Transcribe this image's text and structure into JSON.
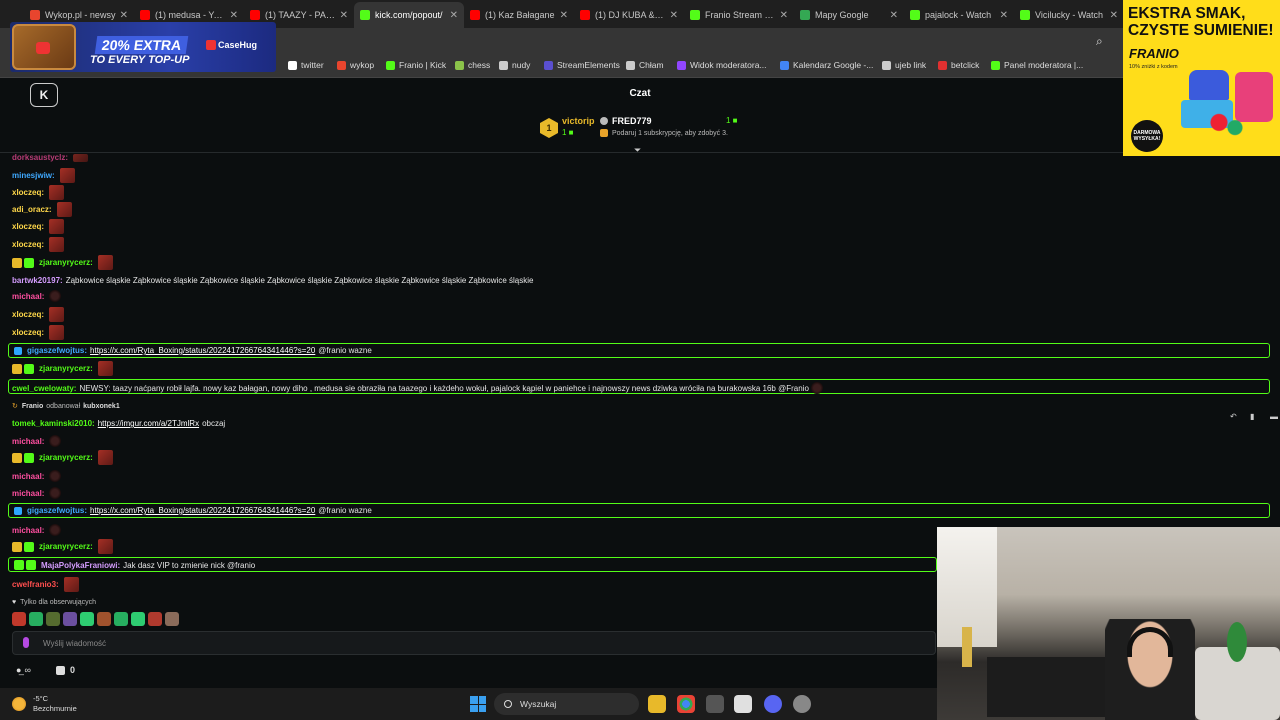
{
  "tabs": [
    {
      "title": "Wykop.pl - newsy",
      "color": "#e8452e",
      "active": false
    },
    {
      "title": "(1) medusa - YouT",
      "color": "#ff0000",
      "active": false
    },
    {
      "title": "(1) TAAZY - PACZ",
      "color": "#ff0000",
      "active": false
    },
    {
      "title": "kick.com/popout/",
      "color": "#53fc18",
      "active": true
    },
    {
      "title": "(1) Kaz Bałagane",
      "color": "#ff0000",
      "active": false
    },
    {
      "title": "(1) DJ KUBA & NE",
      "color": "#ff0000",
      "active": false
    },
    {
      "title": "Franio Stream - W",
      "color": "#53fc18",
      "active": false
    },
    {
      "title": "Mapy Google",
      "color": "#34a853",
      "active": false
    },
    {
      "title": "pajalock - Watch",
      "color": "#53fc18",
      "active": false
    },
    {
      "title": "Vicilucky - Watch",
      "color": "#53fc18",
      "active": false
    }
  ],
  "bookmarks": [
    {
      "label": "twitter",
      "color": "#ffffff"
    },
    {
      "label": "wykop",
      "color": "#e8452e"
    },
    {
      "label": "Franio | Kick",
      "color": "#53fc18"
    },
    {
      "label": "chess",
      "color": "#8bc34a"
    },
    {
      "label": "nudy",
      "color": "#cccccc"
    },
    {
      "label": "StreamElements",
      "color": "#5a4fcf"
    },
    {
      "label": "Chłam",
      "color": "#cccccc"
    },
    {
      "label": "Widok moderatora...",
      "color": "#9146ff"
    },
    {
      "label": "Kalendarz Google -...",
      "color": "#4285f4"
    },
    {
      "label": "ujeb link",
      "color": "#cccccc"
    },
    {
      "label": "betclick",
      "color": "#e03030"
    },
    {
      "label": "Panel moderatora |...",
      "color": "#53fc18"
    }
  ],
  "ad_left": {
    "percent": "20% EXTRA",
    "subline": "TO EVERY TOP-UP",
    "brand": "CaseHug"
  },
  "ad_right": {
    "headline": "EKSTRA SMAK, CZYSTE SUMIENIE!",
    "brand": "FRANIO",
    "small": "10% zniżki z kodem",
    "badge": "DARMOWA WYSYŁKA!"
  },
  "header": {
    "title": "Czat",
    "logo": "K"
  },
  "leaderboard": {
    "rank": "1",
    "user1": "victorip",
    "count1": "1",
    "user2": "FRED779",
    "count2": "1",
    "note": "Podaruj 1 subskrypcję, aby zdobyć 3."
  },
  "chat": [
    {
      "user": "minesjwiw:",
      "color": "#3fa9ff",
      "text": "",
      "link": "",
      "tail": ""
    },
    {
      "user": "xloczeq:",
      "color": "#ffd84a",
      "text": "",
      "link": "",
      "tail": ""
    },
    {
      "user": "adi_oracz:",
      "color": "#ffd84a",
      "text": "",
      "link": "",
      "tail": ""
    },
    {
      "user": "xloczeq:",
      "color": "#ffd84a",
      "text": "",
      "link": "",
      "tail": ""
    },
    {
      "user": "xloczeq:",
      "color": "#ffd84a",
      "text": "",
      "link": "",
      "tail": ""
    },
    {
      "user": "zjaranyrycerz:",
      "color": "#53fc18",
      "text": "",
      "link": "",
      "tail": ""
    },
    {
      "user": "bartwk20197:",
      "color": "#d59dff",
      "text": "Ząbkowice śląskie Ząbkowice śląskie Ząbkowice śląskie Ząbkowice śląskie Ząbkowice śląskie Ząbkowice śląskie Ząbkowice śląskie",
      "link": "",
      "tail": ""
    },
    {
      "user": "michaal:",
      "color": "#ff4fa0",
      "text": "",
      "link": "",
      "tail": ""
    },
    {
      "user": "xloczeq:",
      "color": "#ffd84a",
      "text": "",
      "link": "",
      "tail": ""
    },
    {
      "user": "xloczeq:",
      "color": "#ffd84a",
      "text": "",
      "link": "",
      "tail": ""
    },
    {
      "user": "gigaszefwojtus:",
      "color": "#3fa9ff",
      "text": "",
      "link": "https://x.com/Ryta_Boxing/status/202241726676434144​6?s=20",
      "tail": "@franio   wazne"
    },
    {
      "user": "zjaranyrycerz:",
      "color": "#53fc18",
      "text": "",
      "link": "",
      "tail": ""
    },
    {
      "user": "cwel_cwelowaty:",
      "color": "#53fc18",
      "text": "NEWSY: taazy naćpany robił lajfa. nowy kaz bałagan, nowy diho , medusa sie obraziła na taazego i każdeho wokuł, pajalock kąpiel w paniehce i najnowszy news dziwka wróciła na burakowska 16b @Franio",
      "link": "",
      "tail": ""
    },
    {
      "user": "tomek_kaminski2010:",
      "color": "#53fc18",
      "text": "",
      "link": "https://imgur.com/a/2TJmlRx",
      "tail": "obczaj"
    },
    {
      "user": "michaal:",
      "color": "#ff4fa0",
      "text": "",
      "link": "",
      "tail": ""
    },
    {
      "user": "zjaranyrycerz:",
      "color": "#53fc18",
      "text": "",
      "link": "",
      "tail": ""
    },
    {
      "user": "michaal:",
      "color": "#ff4fa0",
      "text": "",
      "link": "",
      "tail": ""
    },
    {
      "user": "michaal:",
      "color": "#ff4fa0",
      "text": "",
      "link": "",
      "tail": ""
    },
    {
      "user": "gigaszefwojtus:",
      "color": "#3fa9ff",
      "text": "",
      "link": "https://x.com/Ryta_Boxing/status/2022417266764341446?s=20",
      "tail": "@franio   wazne"
    },
    {
      "user": "michaal:",
      "color": "#ff4fa0",
      "text": "",
      "link": "",
      "tail": ""
    },
    {
      "user": "zjaranyrycerz:",
      "color": "#53fc18",
      "text": "",
      "link": "",
      "tail": ""
    },
    {
      "user": "MajaPolykaFraniowi:",
      "color": "#d59dff",
      "text": "Jak dasz VIP to zmienie nick @franio",
      "link": "",
      "tail": ""
    },
    {
      "user": "cwelfranio3:",
      "color": "#ff4f4f",
      "text": "",
      "link": "",
      "tail": ""
    }
  ],
  "system_message": {
    "user": "Franio",
    "action": "odbanował",
    "target": "kubxonek1"
  },
  "followers_only": "Tylko dla obserwujących",
  "input_placeholder": "Wyślij wiadomość",
  "stats": {
    "viewers": "∞",
    "gifts": "0"
  },
  "taskbar": {
    "temp": "-5°C",
    "weather": "Bezchmurnie",
    "search": "Wyszukaj"
  }
}
